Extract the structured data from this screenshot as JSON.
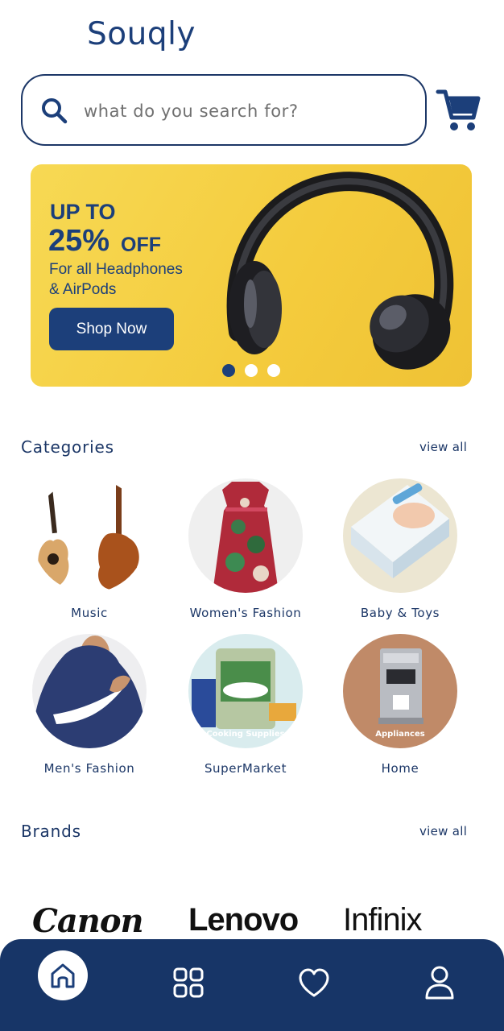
{
  "app": {
    "title": "Souqly"
  },
  "search": {
    "placeholder": "what do you search for?"
  },
  "header": {
    "cart_icon": "cart-icon"
  },
  "banner": {
    "line1": "UP TO",
    "percent": "25%",
    "off": "OFF",
    "sub1": "For all Headphones",
    "sub2": "& AirPods",
    "button": "Shop Now",
    "slides": 3,
    "active_slide": 1
  },
  "categories": {
    "title": "Categories",
    "view_all": "view all",
    "items": [
      {
        "label": "Music"
      },
      {
        "label": "Women's Fashion"
      },
      {
        "label": "Baby & Toys"
      },
      {
        "label": "Men's Fashion"
      },
      {
        "label": "SuperMarket",
        "overlay": "Cooking Supplies"
      },
      {
        "label": "Home",
        "overlay": "Appliances"
      }
    ]
  },
  "brands": {
    "title": "Brands",
    "view_all": "view all",
    "items": [
      {
        "name": "Canon"
      },
      {
        "name": "Lenovo"
      },
      {
        "name": "Infinix"
      }
    ]
  },
  "nav": {
    "items": [
      "home-icon",
      "grid-icon",
      "heart-icon",
      "user-icon"
    ],
    "active": "home-icon"
  },
  "colors": {
    "primary": "#1c3f7a",
    "banner": "#f4cb3c",
    "nav": "#173567"
  }
}
